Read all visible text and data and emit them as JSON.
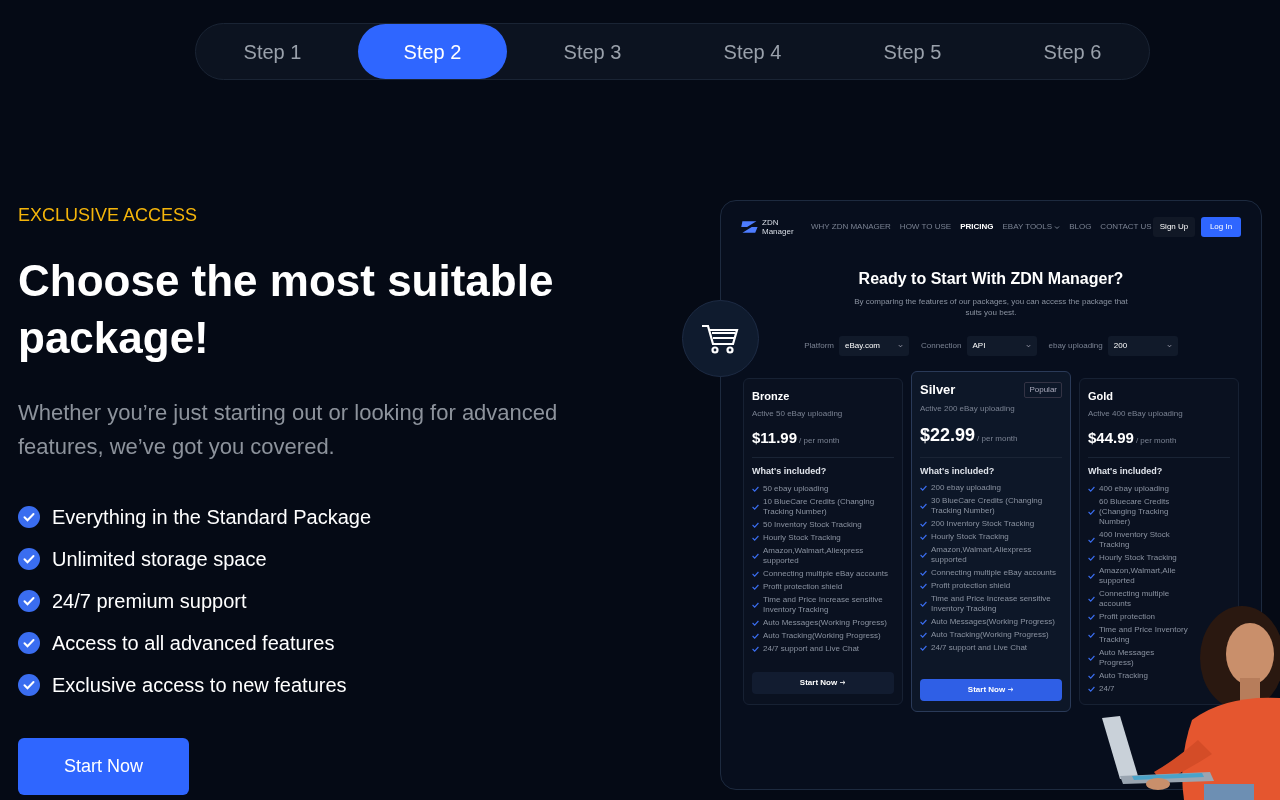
{
  "steps": [
    {
      "label": "Step 1",
      "selected": false
    },
    {
      "label": "Step 2",
      "selected": true
    },
    {
      "label": "Step 3",
      "selected": false
    },
    {
      "label": "Step 4",
      "selected": false
    },
    {
      "label": "Step 5",
      "selected": false
    },
    {
      "label": "Step 6",
      "selected": false
    }
  ],
  "hero": {
    "eyebrow": "EXCLUSIVE ACCESS",
    "title": "Choose the most suitable package!",
    "description": "Whether you’re just starting out or looking for advanced features, we’ve got you covered.",
    "features": [
      "Everything in the Standard Package",
      "Unlimited storage space",
      "24/7 premium support",
      "Access to all advanced features",
      "Exclusive access to new features"
    ],
    "button": "Start Now"
  },
  "preview": {
    "logo": "ZDN Manager",
    "links": [
      {
        "label": "WHY ZDN MANAGER",
        "selected": false,
        "caret": false
      },
      {
        "label": "HOW TO USE",
        "selected": false,
        "caret": false
      },
      {
        "label": "PRICING",
        "selected": true,
        "caret": false
      },
      {
        "label": "EBAY TOOLS",
        "selected": false,
        "caret": true
      },
      {
        "label": "BLOG",
        "selected": false,
        "caret": false
      },
      {
        "label": "CONTACT US",
        "selected": false,
        "caret": false
      }
    ],
    "sign_up": "Sign Up",
    "log_in": "Log In",
    "title": "Ready to Start With ZDN Manager?",
    "subtitle": "By comparing the features of our packages, you can access the package that suits you best.",
    "filters": [
      {
        "label": "Platform",
        "value": "eBay.com"
      },
      {
        "label": "Connection",
        "value": "API"
      },
      {
        "label": "ebay uploading",
        "value": "200"
      }
    ],
    "plans": [
      {
        "name": "Bronze",
        "featured": false,
        "subtitle": "Active 50 eBay uploading",
        "price": "$11.99",
        "period": "/ per month",
        "included": "What's included?",
        "button": "Start Now",
        "features": [
          "50 ebay uploading",
          "10 BlueCare Credits (Changing Tracking Number)",
          "50 Inventory Stock Tracking",
          "Hourly Stock Tracking",
          "Amazon,Walmart,Aliexpress supported",
          "Connecting multiple eBay accounts",
          "Profit protection shield",
          "Time and Price Increase sensitive Inventory Tracking",
          "Auto Messages(Working Progress)",
          "Auto Tracking(Working Progress)",
          "24/7 support and Live Chat"
        ]
      },
      {
        "name": "Silver",
        "featured": true,
        "badge": "Popular",
        "subtitle": "Active 200 eBay uploading",
        "price": "$22.99",
        "period": "/ per month",
        "included": "What's included?",
        "button": "Start Now",
        "features": [
          "200 ebay uploading",
          "30 BlueCare Credits (Changing Tracking Number)",
          "200 Inventory Stock Tracking",
          "Hourly Stock Tracking",
          "Amazon,Walmart,Aliexpress supported",
          "Connecting multiple eBay accounts",
          "Profit protection shield",
          "Time and Price Increase sensitive Inventory Tracking",
          "Auto Messages(Working Progress)",
          "Auto Tracking(Working Progress)",
          "24/7 support and Live Chat"
        ]
      },
      {
        "name": "Gold",
        "featured": false,
        "subtitle": "Active 400 eBay uploading",
        "price": "$44.99",
        "period": "/ per month",
        "included": "What's included?",
        "features": [
          "400 ebay uploading",
          "60 Bluecare Credits (Changing Tracking Number)",
          "400 Inventory Stock Tracking",
          "Hourly Stock Tracking",
          "Amazon,Walmart,Alie supported",
          "Connecting multiple accounts",
          "Profit protection",
          "Time and Price Inventory Tracking",
          "Auto Messages Progress)",
          "Auto Tracking",
          "24/7"
        ]
      }
    ]
  }
}
